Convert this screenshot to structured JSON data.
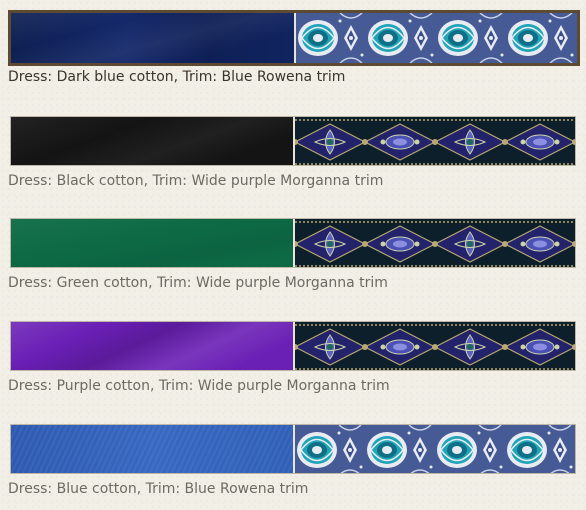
{
  "colors": {
    "page_background": "#f2efe7",
    "selected_border": "#5c4a32",
    "caption_text": "#6e6a62",
    "selected_caption_text": "#3a342a"
  },
  "options": [
    {
      "caption": "Dress: Dark blue cotton, Trim: Blue Rowena trim",
      "selected": true,
      "fabric_color": "#14286a",
      "trim_pattern": "blue-rowena"
    },
    {
      "caption": "Dress: Black cotton, Trim: Wide purple Morganna trim",
      "selected": false,
      "fabric_color": "#141414",
      "trim_pattern": "purple-morganna"
    },
    {
      "caption": "Dress: Green cotton, Trim: Wide purple Morganna trim",
      "selected": false,
      "fabric_color": "#0d6a45",
      "trim_pattern": "purple-morganna"
    },
    {
      "caption": "Dress: Purple cotton, Trim: Wide purple Morganna trim",
      "selected": false,
      "fabric_color": "#6a1fb5",
      "trim_pattern": "purple-morganna"
    },
    {
      "caption": "Dress: Blue cotton, Trim: Blue Rowena trim",
      "selected": false,
      "fabric_color": "#3868c2",
      "trim_pattern": "blue-rowena"
    }
  ]
}
